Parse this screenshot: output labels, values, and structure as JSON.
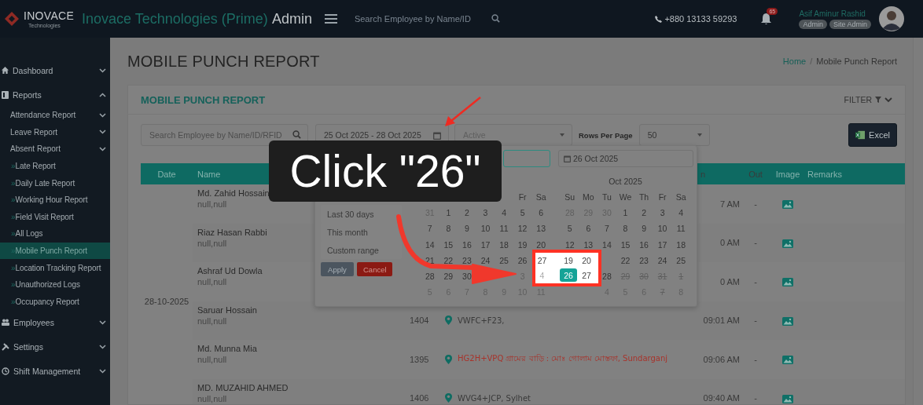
{
  "header": {
    "brand": "INOVACE",
    "brand_sub": "Technologies",
    "title_main": "Inovace Technologies (Prime)",
    "title_suffix": "Admin",
    "search": {
      "placeholder": "Search Employee by Name/ID"
    },
    "phone": "+880 13133 59293",
    "notifications": "65",
    "user": {
      "name": "Asif Aminur Rashid",
      "roles": [
        "Admin",
        "Site Admin"
      ]
    }
  },
  "sidebar": {
    "items": [
      {
        "label": "Dashboard",
        "expanded": false,
        "selected": false
      },
      {
        "label": "Reports",
        "expanded": true,
        "selected": false,
        "children": [
          {
            "label": "Attendance Report",
            "kind": "group",
            "expanded": false,
            "selected": false
          },
          {
            "label": "Leave Report",
            "kind": "group",
            "expanded": false,
            "selected": false
          },
          {
            "label": "Absent Report",
            "kind": "group",
            "expanded": false,
            "selected": false
          },
          {
            "label": "Late Report",
            "kind": "link",
            "bullet": "»",
            "selected": false
          },
          {
            "label": "Daily Late Report",
            "kind": "link",
            "bullet": "»",
            "selected": false
          },
          {
            "label": "Working Hour Report",
            "kind": "link",
            "bullet": "»",
            "selected": false
          },
          {
            "label": "Field Visit Report",
            "kind": "link",
            "bullet": "»",
            "selected": false
          },
          {
            "label": "All Logs",
            "kind": "link",
            "bullet": "»",
            "selected": false
          },
          {
            "label": "Mobile Punch Report",
            "kind": "link",
            "bullet": "»",
            "selected": true
          },
          {
            "label": "Location Tracking Report",
            "kind": "link",
            "bullet": "»",
            "selected": false
          },
          {
            "label": "Unauthorized Logs",
            "kind": "link",
            "bullet": "»",
            "selected": false
          },
          {
            "label": "Occupancy Report",
            "kind": "link",
            "bullet": "»",
            "selected": false
          }
        ]
      },
      {
        "label": "Employees",
        "expanded": false,
        "selected": false
      },
      {
        "label": "Settings",
        "expanded": false,
        "selected": false
      },
      {
        "label": "Shift Management",
        "expanded": false,
        "selected": false
      }
    ]
  },
  "page": {
    "title": "MOBILE PUNCH REPORT",
    "breadcrumb": {
      "items": [
        "Home",
        "Mobile Punch Report"
      ],
      "separator": "/"
    }
  },
  "card": {
    "title": "MOBILE PUNCH REPORT",
    "filter_label": "FILTER",
    "filters": {
      "search_placeholder": "Search Employee by Name/ID/RFID",
      "date_range": "25 Oct 2025 - 28 Oct 2025",
      "status": "Active",
      "rows_label": "Rows Per Page",
      "rows_per_page": "50",
      "export": "Excel"
    }
  },
  "table": {
    "columns": [
      "Date",
      "Name",
      "n",
      "Out",
      "Image",
      "Remarks"
    ],
    "groups": [
      {
        "date": "28-10-2025",
        "rows": [
          {
            "name": "Md. Zahid Hossain",
            "sub": "null,null",
            "in": "7 AM",
            "out": "-"
          },
          {
            "name": "Riaz Hasan Rabbi",
            "sub": "null,null",
            "in": "0 AM",
            "out": "-"
          },
          {
            "name": "Ashraf Ud Dowla",
            "sub": "null,null",
            "in": "0 AM",
            "out": "-"
          },
          {
            "name": "Saruar Hossain",
            "sub": "null,null",
            "id": "1404",
            "location": {
              "text": "VWFC+F23,",
              "color": "#3a3a3a"
            },
            "in": "09:01 AM",
            "out": "-"
          },
          {
            "name": "Md. Munna Mia",
            "sub": "null,null",
            "id": "1395",
            "location": {
              "text": "HG2H+VPQ গ্রামের বাড়ি : মোঃ গোলাম মোস্তফা, Sundarganj",
              "color": "#a8332b"
            },
            "in": "09:06 AM",
            "out": "-"
          },
          {
            "name": "MD. MUZAHID AHMED",
            "sub": "null,null",
            "id": "1406",
            "location": {
              "text": "WVG4+JCP, Sylhet",
              "color": "#3a3a3a"
            },
            "in": "09:40 AM",
            "out": "-"
          }
        ]
      }
    ]
  },
  "date_picker": {
    "ranges": [
      {
        "label": "Last 30 days",
        "selected": false
      },
      {
        "label": "This month",
        "selected": false
      },
      {
        "label": "Custom range",
        "selected": false
      }
    ],
    "apply": "Apply",
    "cancel": "Cancel",
    "end_input": "26 Oct 2025",
    "calendars": [
      {
        "weekdays": [
          "Fr",
          "Sa"
        ],
        "weeks": [
          [
            {
              "d": "31",
              "kind": "muted"
            },
            {
              "d": "1",
              "kind": "day"
            },
            {
              "d": "2",
              "kind": "day"
            },
            {
              "d": "3",
              "kind": "day"
            },
            {
              "d": "4",
              "kind": "day"
            },
            {
              "d": "5",
              "kind": "day"
            },
            {
              "d": "6",
              "kind": "day"
            }
          ],
          [
            {
              "d": "7",
              "kind": "day"
            },
            {
              "d": "8",
              "kind": "day"
            },
            {
              "d": "9",
              "kind": "day"
            },
            {
              "d": "10",
              "kind": "day"
            },
            {
              "d": "11",
              "kind": "day"
            },
            {
              "d": "12",
              "kind": "day"
            },
            {
              "d": "13",
              "kind": "day"
            }
          ],
          [
            {
              "d": "14",
              "kind": "day"
            },
            {
              "d": "15",
              "kind": "day"
            },
            {
              "d": "16",
              "kind": "day"
            },
            {
              "d": "17",
              "kind": "day"
            },
            {
              "d": "18",
              "kind": "day"
            },
            {
              "d": "19",
              "kind": "day"
            },
            {
              "d": "20",
              "kind": "day"
            }
          ],
          [
            {
              "d": "21",
              "kind": "day"
            },
            {
              "d": "22",
              "kind": "day"
            },
            {
              "d": "23",
              "kind": "day"
            },
            {
              "d": "24",
              "kind": "day"
            },
            {
              "d": "25",
              "kind": "day"
            },
            {
              "d": "26",
              "kind": "day"
            },
            {
              "kind": "covered"
            }
          ],
          [
            {
              "d": "28",
              "kind": "day"
            },
            {
              "d": "29",
              "kind": "day"
            },
            {
              "d": "30",
              "kind": "day"
            },
            {
              "kind": "covered"
            },
            {
              "kind": "covered"
            },
            {
              "d": "3",
              "kind": "muted"
            },
            {
              "kind": "covered"
            }
          ],
          [
            {
              "d": "5",
              "kind": "muted"
            },
            {
              "d": "6",
              "kind": "muted"
            },
            {
              "d": "7",
              "kind": "muted"
            },
            {
              "d": "8",
              "kind": "muted"
            },
            {
              "d": "9",
              "kind": "muted"
            },
            {
              "d": "10",
              "kind": "muted"
            },
            {
              "d": "11",
              "kind": "muted"
            }
          ]
        ]
      },
      {
        "month": "Oct 2025",
        "weekdays": [
          "Su",
          "Mo",
          "Tu",
          "We",
          "Th",
          "Fr",
          "Sa"
        ],
        "weeks": [
          [
            {
              "d": "28",
              "kind": "muted"
            },
            {
              "d": "29",
              "kind": "muted"
            },
            {
              "d": "30",
              "kind": "muted"
            },
            {
              "d": "1",
              "kind": "day"
            },
            {
              "d": "2",
              "kind": "day"
            },
            {
              "d": "3",
              "kind": "day"
            },
            {
              "d": "4",
              "kind": "day"
            }
          ],
          [
            {
              "d": "5",
              "kind": "day"
            },
            {
              "d": "6",
              "kind": "day"
            },
            {
              "d": "7",
              "kind": "day"
            },
            {
              "d": "8",
              "kind": "day"
            },
            {
              "d": "9",
              "kind": "day"
            },
            {
              "d": "10",
              "kind": "day"
            },
            {
              "d": "11",
              "kind": "day"
            }
          ],
          [
            {
              "d": "12",
              "kind": "day"
            },
            {
              "d": "13",
              "kind": "day"
            },
            {
              "d": "14",
              "kind": "day"
            },
            {
              "d": "15",
              "kind": "day"
            },
            {
              "d": "16",
              "kind": "day"
            },
            {
              "d": "17",
              "kind": "day"
            },
            {
              "d": "18",
              "kind": "day"
            }
          ],
          [
            {
              "kind": "covered"
            },
            {
              "kind": "covered"
            },
            {
              "kind": "covered"
            },
            {
              "d": "22",
              "kind": "day"
            },
            {
              "d": "23",
              "kind": "day"
            },
            {
              "d": "24",
              "kind": "day"
            },
            {
              "d": "25",
              "kind": "day"
            }
          ],
          [
            {
              "kind": "covered"
            },
            {
              "kind": "covered"
            },
            {
              "d": "28",
              "kind": "day"
            },
            {
              "d": "29",
              "kind": "struck"
            },
            {
              "d": "30",
              "kind": "struck"
            },
            {
              "d": "31",
              "kind": "struck"
            },
            {
              "d": "1",
              "kind": "struck"
            }
          ],
          [
            {
              "kind": "covered"
            },
            {
              "kind": "covered"
            },
            {
              "d": "4",
              "kind": "muted"
            },
            {
              "d": "5",
              "kind": "muted"
            },
            {
              "d": "6",
              "kind": "muted"
            },
            {
              "d": "7",
              "kind": "struck"
            },
            {
              "d": "8",
              "kind": "muted"
            }
          ]
        ]
      }
    ]
  },
  "annotation": {
    "callout": "Click \"26\"",
    "highlight": {
      "rows": [
        [
          {
            "d": "27",
            "kind": "day",
            "selected": false
          },
          {
            "d": "19",
            "kind": "day",
            "selected": false
          },
          {
            "d": "20",
            "kind": "day",
            "selected": false
          }
        ],
        [
          {
            "d": "4",
            "kind": "muted",
            "selected": false
          },
          {
            "d": "26",
            "kind": "day",
            "selected": true
          },
          {
            "d": "27",
            "kind": "day",
            "selected": false
          }
        ]
      ]
    }
  }
}
